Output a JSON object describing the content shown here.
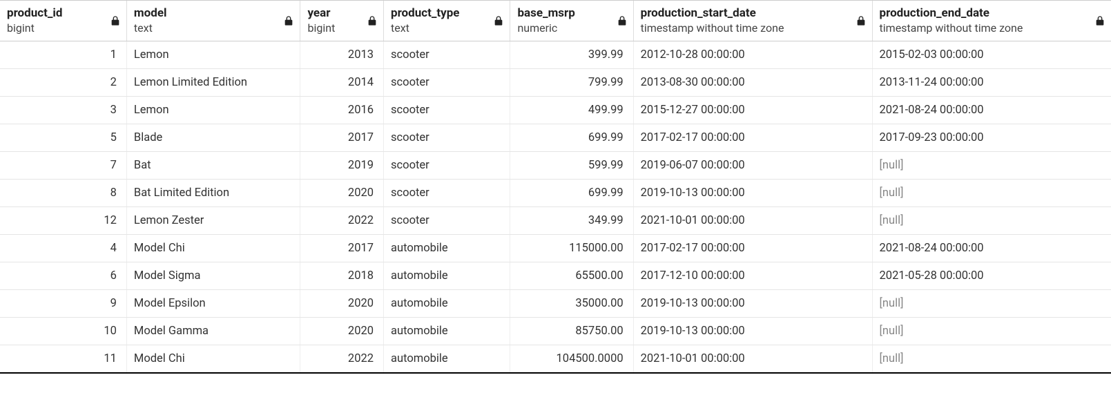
{
  "null_label": "[null]",
  "columns": [
    {
      "key": "product_id",
      "name": "product_id",
      "type": "bigint",
      "align": "right",
      "locked": true
    },
    {
      "key": "model",
      "name": "model",
      "type": "text",
      "align": "left",
      "locked": true
    },
    {
      "key": "year",
      "name": "year",
      "type": "bigint",
      "align": "right",
      "locked": true
    },
    {
      "key": "product_type",
      "name": "product_type",
      "type": "text",
      "align": "left",
      "locked": true
    },
    {
      "key": "base_msrp",
      "name": "base_msrp",
      "type": "numeric",
      "align": "right",
      "locked": true
    },
    {
      "key": "production_start_date",
      "name": "production_start_date",
      "type": "timestamp without time zone",
      "align": "left",
      "locked": true
    },
    {
      "key": "production_end_date",
      "name": "production_end_date",
      "type": "timestamp without time zone",
      "align": "left",
      "locked": true
    }
  ],
  "rows": [
    {
      "product_id": "1",
      "model": "Lemon",
      "year": "2013",
      "product_type": "scooter",
      "base_msrp": "399.99",
      "production_start_date": "2012-10-28 00:00:00",
      "production_end_date": "2015-02-03 00:00:00"
    },
    {
      "product_id": "2",
      "model": "Lemon Limited Edition",
      "year": "2014",
      "product_type": "scooter",
      "base_msrp": "799.99",
      "production_start_date": "2013-08-30 00:00:00",
      "production_end_date": "2013-11-24 00:00:00"
    },
    {
      "product_id": "3",
      "model": "Lemon",
      "year": "2016",
      "product_type": "scooter",
      "base_msrp": "499.99",
      "production_start_date": "2015-12-27 00:00:00",
      "production_end_date": "2021-08-24 00:00:00"
    },
    {
      "product_id": "5",
      "model": "Blade",
      "year": "2017",
      "product_type": "scooter",
      "base_msrp": "699.99",
      "production_start_date": "2017-02-17 00:00:00",
      "production_end_date": "2017-09-23 00:00:00"
    },
    {
      "product_id": "7",
      "model": "Bat",
      "year": "2019",
      "product_type": "scooter",
      "base_msrp": "599.99",
      "production_start_date": "2019-06-07 00:00:00",
      "production_end_date": null
    },
    {
      "product_id": "8",
      "model": "Bat Limited Edition",
      "year": "2020",
      "product_type": "scooter",
      "base_msrp": "699.99",
      "production_start_date": "2019-10-13 00:00:00",
      "production_end_date": null
    },
    {
      "product_id": "12",
      "model": "Lemon Zester",
      "year": "2022",
      "product_type": "scooter",
      "base_msrp": "349.99",
      "production_start_date": "2021-10-01 00:00:00",
      "production_end_date": null
    },
    {
      "product_id": "4",
      "model": "Model Chi",
      "year": "2017",
      "product_type": "automobile",
      "base_msrp": "115000.00",
      "production_start_date": "2017-02-17 00:00:00",
      "production_end_date": "2021-08-24 00:00:00"
    },
    {
      "product_id": "6",
      "model": "Model Sigma",
      "year": "2018",
      "product_type": "automobile",
      "base_msrp": "65500.00",
      "production_start_date": "2017-12-10 00:00:00",
      "production_end_date": "2021-05-28 00:00:00"
    },
    {
      "product_id": "9",
      "model": "Model Epsilon",
      "year": "2020",
      "product_type": "automobile",
      "base_msrp": "35000.00",
      "production_start_date": "2019-10-13 00:00:00",
      "production_end_date": null
    },
    {
      "product_id": "10",
      "model": "Model Gamma",
      "year": "2020",
      "product_type": "automobile",
      "base_msrp": "85750.00",
      "production_start_date": "2019-10-13 00:00:00",
      "production_end_date": null
    },
    {
      "product_id": "11",
      "model": "Model Chi",
      "year": "2022",
      "product_type": "automobile",
      "base_msrp": "104500.0000",
      "production_start_date": "2021-10-01 00:00:00",
      "production_end_date": null
    }
  ]
}
